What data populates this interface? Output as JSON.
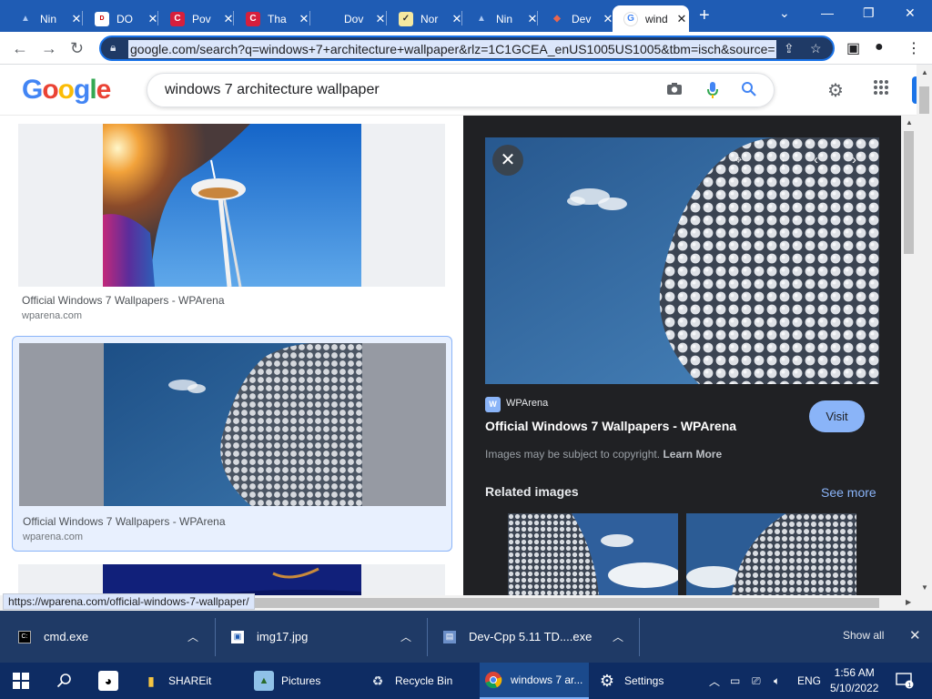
{
  "browser": {
    "tabs": [
      {
        "label": "Nin",
        "favicon": "person-icon",
        "close": "✕"
      },
      {
        "label": "DO",
        "favicon": "doc-icon",
        "close": "✕"
      },
      {
        "label": "Pov",
        "favicon": "c-icon",
        "close": "✕"
      },
      {
        "label": "Tha",
        "favicon": "c-icon",
        "close": "✕"
      },
      {
        "label": "Dov",
        "favicon": "apple-icon",
        "close": "✕"
      },
      {
        "label": "Nor",
        "favicon": "check-icon",
        "close": "✕"
      },
      {
        "label": "Nin",
        "favicon": "person-icon",
        "close": "✕"
      },
      {
        "label": "Dev",
        "favicon": "diamond-icon",
        "close": "✕"
      },
      {
        "label": "wind",
        "favicon": "google-icon",
        "close": "✕"
      }
    ],
    "new_tab": "+",
    "url": "google.com/search?q=windows+7+architecture+wallpaper&rlz=1C1GCEA_enUS1005US1005&tbm=isch&source=",
    "status_url": "https://wparena.com/official-windows-7-wallpaper/"
  },
  "google": {
    "logo": [
      "G",
      "o",
      "o",
      "g",
      "l",
      "e"
    ],
    "logo_colors": [
      "#4285f4",
      "#ea4335",
      "#fbbc05",
      "#4285f4",
      "#34a853",
      "#ea4335"
    ],
    "query": "windows 7 architecture wallpaper"
  },
  "results": [
    {
      "title": "Official Windows 7 Wallpapers - WPArena",
      "site": "wparena.com"
    },
    {
      "title": "Official Windows 7 Wallpapers - WPArena",
      "site": "wparena.com"
    }
  ],
  "preview": {
    "source": "WPArena",
    "title": "Official Windows 7 Wallpapers - WPArena",
    "visit": "Visit",
    "copyright": "Images may be subject to copyright.",
    "learn_more": "Learn More",
    "related": "Related images",
    "see_more": "See more"
  },
  "downloads": {
    "items": [
      {
        "name": "cmd.exe"
      },
      {
        "name": "img17.jpg"
      },
      {
        "name": "Dev-Cpp 5.11 TD....exe"
      }
    ],
    "show_all": "Show all"
  },
  "taskbar": {
    "items": [
      {
        "label": "SHAREit"
      },
      {
        "label": "Pictures"
      },
      {
        "label": "Recycle Bin"
      },
      {
        "label": "windows 7 ar..."
      },
      {
        "label": "Settings"
      }
    ],
    "language": "ENG",
    "time": "1:56 AM",
    "date": "5/10/2022"
  }
}
